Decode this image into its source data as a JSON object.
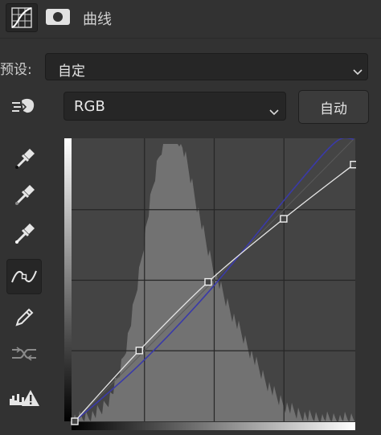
{
  "header": {
    "title": "曲线",
    "curves_icon": "curves-adjustment-icon",
    "mask_icon": "layer-mask-icon"
  },
  "preset": {
    "label": "预设:",
    "value": "自定"
  },
  "channel": {
    "value": "RGB"
  },
  "auto_button": {
    "label": "自动"
  },
  "tools": [
    {
      "name": "on-image-adjust-icon"
    },
    {
      "name": "black-point-eyedropper-icon"
    },
    {
      "name": "gray-point-eyedropper-icon"
    },
    {
      "name": "white-point-eyedropper-icon"
    },
    {
      "name": "curve-point-edit-icon",
      "active": true
    },
    {
      "name": "pencil-draw-icon"
    },
    {
      "name": "smooth-curve-icon"
    },
    {
      "name": "clipping-warning-icon"
    }
  ],
  "colors": {
    "panel_bg": "#323232",
    "graph_bg": "#444444",
    "histogram": "#727272",
    "rgb_curve": "#e6e6e6",
    "blue_curve": "#3a3aa8"
  },
  "curve": {
    "channel": "RGB",
    "input_range": [
      0,
      255
    ],
    "output_range": [
      0,
      255
    ],
    "points": [
      {
        "input": 0,
        "output": 0
      },
      {
        "input": 59,
        "output": 64
      },
      {
        "input": 122,
        "output": 126
      },
      {
        "input": 191,
        "output": 183
      },
      {
        "input": 255,
        "output": 232
      }
    ]
  }
}
